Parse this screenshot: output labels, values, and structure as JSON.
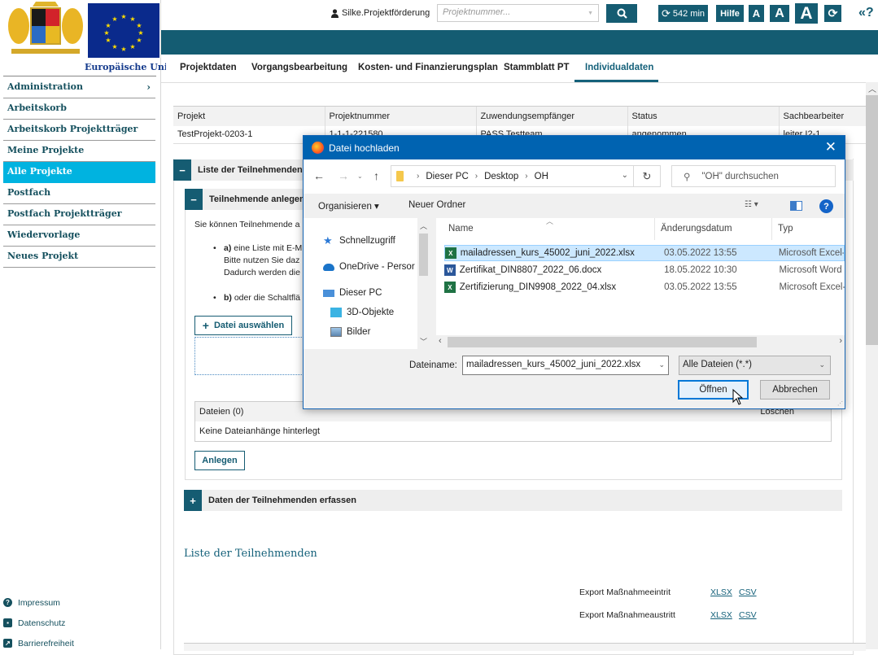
{
  "sidebar": {
    "eu_label": "Europäische Union",
    "items": [
      {
        "label": "Administration",
        "has_submenu": true
      },
      {
        "label": "Arbeitskorb"
      },
      {
        "label": "Arbeitskorb Projektträger"
      },
      {
        "label": "Meine Projekte"
      },
      {
        "label": "Alle Projekte",
        "active": true
      },
      {
        "label": "Postfach"
      },
      {
        "label": "Postfach Projektträger"
      },
      {
        "label": "Wiedervorlage"
      },
      {
        "label": "Neues Projekt"
      }
    ],
    "footer": [
      {
        "label": "Impressum",
        "icon": "question-circle-icon"
      },
      {
        "label": "Datenschutz",
        "icon": "id-card-icon"
      },
      {
        "label": "Barrierefreiheit",
        "icon": "external-link-icon"
      }
    ]
  },
  "topbar": {
    "user": "Silke.Projektförderung",
    "project_placeholder": "Projektnummer...",
    "timer": "542 min",
    "help": "Hilfe",
    "font_small": "A",
    "font_medium": "A",
    "font_large": "A",
    "help_link": "«?"
  },
  "tabs": [
    {
      "label": "Projektdaten"
    },
    {
      "label": "Vorgangsbearbeitung"
    },
    {
      "label": "Kosten- und Finanzierungsplan"
    },
    {
      "label": "Stammblatt PT"
    },
    {
      "label": "Individualdaten",
      "active": true
    }
  ],
  "project_table": {
    "headers": [
      "Projekt",
      "Projektnummer",
      "Zuwendungsempfänger",
      "Status",
      "Sachbearbeiter"
    ],
    "row": [
      "TestProjekt-0203-1",
      "1-1-1-221580",
      "PASS Testteam",
      "angenommen",
      "leiter I2-1"
    ]
  },
  "sections": {
    "list_title": "Liste der Teilnehmenden",
    "create_title": "Teilnehmende anlegen",
    "intro": "Sie können Teilnehmende a",
    "bullet_a_bold": "a)",
    "bullet_a": " eine Liste mit E-M",
    "bullet_a_line2": "Bitte nutzen Sie daz",
    "bullet_a_line3": "Dadurch werden die",
    "bullet_b_bold": "b)",
    "bullet_b": " oder die Schaltflä",
    "select_file_button": "Datei auswählen",
    "files_header": "Dateien (0)",
    "files_delete_header": "Löschen",
    "files_empty": "Keine Dateianhänge hinterlegt",
    "create_button": "Anlegen",
    "capture_title": "Daten der Teilnehmenden erfassen",
    "participants_list_title": "Liste der Teilnehmenden",
    "exports": [
      {
        "label": "Export Maßnahmeeintrit",
        "xlsx": "XLSX",
        "csv": "CSV"
      },
      {
        "label": "Export Maßnahmeaustritt",
        "xlsx": "XLSX",
        "csv": "CSV"
      }
    ]
  },
  "dialog": {
    "title": "Datei hochladen",
    "path": [
      "Dieser PC",
      "Desktop",
      "OH"
    ],
    "search_placeholder": "\"OH\" durchsuchen",
    "organize": "Organisieren ▾",
    "new_folder": "Neuer Ordner",
    "nav_items": [
      {
        "label": "Schnellzugriff",
        "icon": "star-icon"
      },
      {
        "label": "OneDrive - Persor",
        "icon": "cloud-icon"
      },
      {
        "label": "Dieser PC",
        "icon": "computer-icon"
      },
      {
        "label": "3D-Objekte",
        "icon": "cube-icon"
      },
      {
        "label": "Bilder",
        "icon": "image-icon"
      }
    ],
    "columns": [
      "Name",
      "Änderungsdatum",
      "Typ"
    ],
    "files": [
      {
        "name": "mailadressen_kurs_45002_juni_2022.xlsx",
        "date": "03.05.2022 13:55",
        "type": "Microsoft Excel-",
        "kind": "excel",
        "selected": true
      },
      {
        "name": "Zertifikat_DIN8807_2022_06.docx",
        "date": "18.05.2022 10:30",
        "type": "Microsoft Word",
        "kind": "word"
      },
      {
        "name": "Zertifizierung_DIN9908_2022_04.xlsx",
        "date": "03.05.2022 13:55",
        "type": "Microsoft Excel-",
        "kind": "excel"
      }
    ],
    "filename_label": "Dateiname:",
    "filename_value": "mailadressen_kurs_45002_juni_2022.xlsx",
    "filetype": "Alle Dateien (*.*)",
    "open_button": "Öffnen",
    "cancel_button": "Abbrechen"
  },
  "colors": {
    "brand": "#145c72",
    "active_nav": "#00b3e0",
    "dialog_title": "#0063b1",
    "selection": "#cce8ff"
  }
}
